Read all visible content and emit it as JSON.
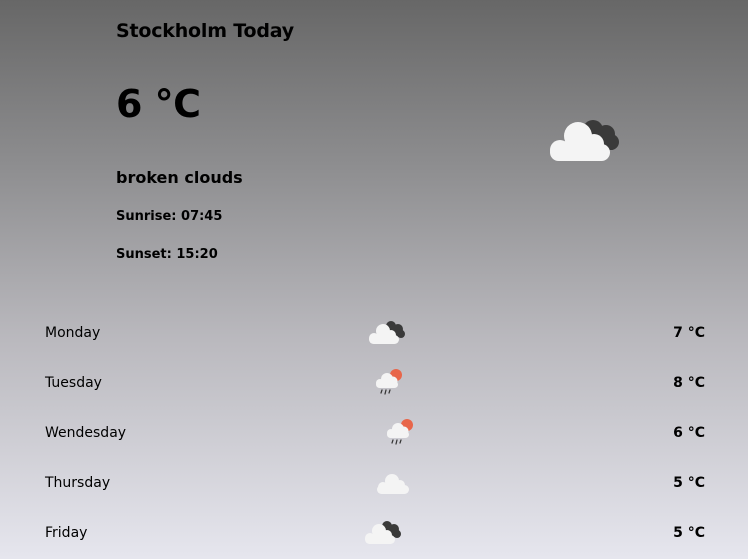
{
  "current": {
    "title": "Stockholm Today",
    "temperature": "6 °C",
    "description": "broken clouds",
    "sunrise": "Sunrise: 07:45",
    "sunset": "Sunset: 15:20",
    "icon": "broken-clouds-icon"
  },
  "forecast": [
    {
      "day": "Monday",
      "temp": "7 °C",
      "icon": "broken-clouds-icon"
    },
    {
      "day": "Tuesday",
      "temp": "8 °C",
      "icon": "rain-sun-icon"
    },
    {
      "day": "Wendesday",
      "temp": "6 °C",
      "icon": "rain-sun-icon"
    },
    {
      "day": "Thursday",
      "temp": "5 °C",
      "icon": "cloud-icon"
    },
    {
      "day": "Friday",
      "temp": "5 °C",
      "icon": "broken-clouds-icon"
    }
  ],
  "colors": {
    "cloud_white": "#f4f4f4",
    "cloud_dark": "#3a3a3a",
    "sun": "#e8664a",
    "rain": "#333333"
  }
}
